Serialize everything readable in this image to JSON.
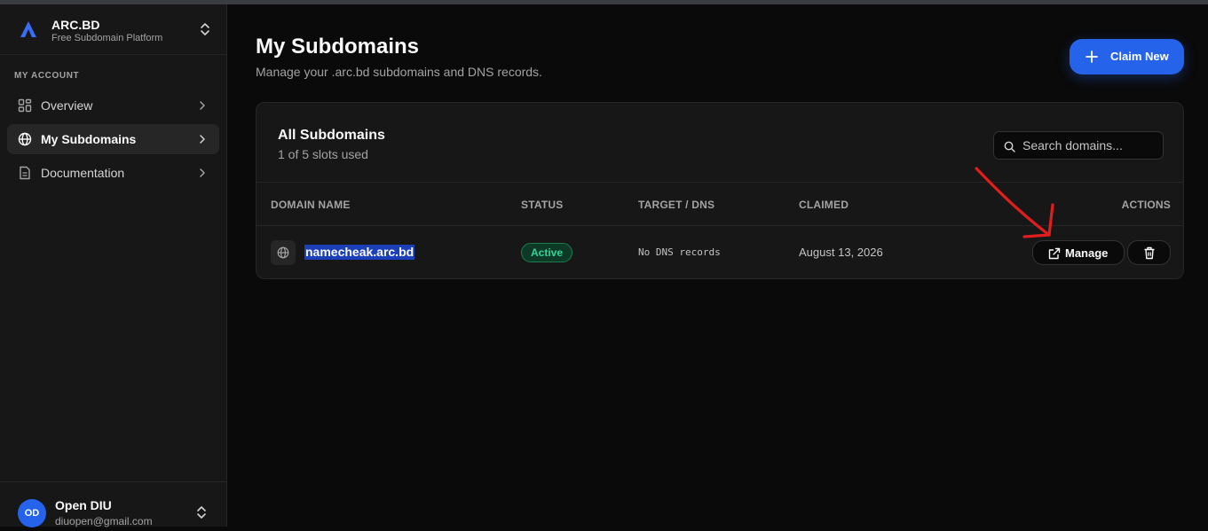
{
  "brand": {
    "name": "ARC.BD",
    "tagline": "Free Subdomain Platform"
  },
  "sidebar": {
    "section_label": "MY ACCOUNT",
    "items": [
      {
        "label": "Overview",
        "icon": "grid-icon",
        "active": false
      },
      {
        "label": "My Subdomains",
        "icon": "globe-icon",
        "active": true
      },
      {
        "label": "Documentation",
        "icon": "document-icon",
        "active": false
      }
    ]
  },
  "user": {
    "initials": "OD",
    "name": "Open DIU",
    "email": "diuopen@gmail.com"
  },
  "header": {
    "title": "My Subdomains",
    "subtitle": "Manage your .arc.bd subdomains and DNS records.",
    "claim_label": "Claim New"
  },
  "card": {
    "title": "All Subdomains",
    "slots": "1 of 5 slots used",
    "search_placeholder": "Search domains..."
  },
  "table": {
    "columns": [
      "DOMAIN NAME",
      "STATUS",
      "TARGET / DNS",
      "CLAIMED",
      "ACTIONS"
    ],
    "rows": [
      {
        "domain": "namecheak.arc.bd",
        "status": "Active",
        "target": "No DNS records",
        "claimed": "August 13, 2026",
        "action_label": "Manage"
      }
    ]
  },
  "colors": {
    "accent": "#2563eb",
    "status_active": "#34d399",
    "annotation_arrow": "#e11d1d"
  }
}
